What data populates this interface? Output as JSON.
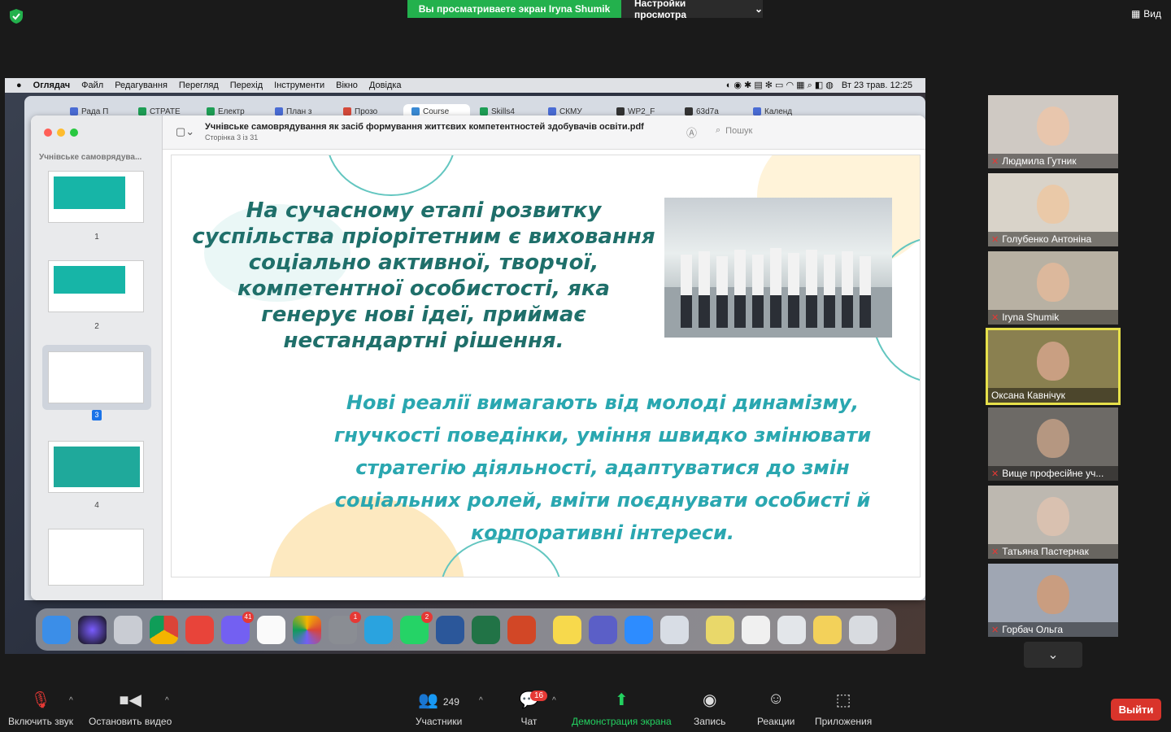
{
  "banner": {
    "viewing": "Вы просматриваете экран Iryna Shumik",
    "settings": "Настройки просмотра",
    "view": "Вид"
  },
  "menubar": {
    "items": [
      "Оглядач",
      "Файл",
      "Редагування",
      "Перегляд",
      "Перехід",
      "Інструменти",
      "Вікно",
      "Довідка"
    ],
    "datetime": "Вт 23 трав.  12:25"
  },
  "browser_tabs": [
    {
      "label": "Рада П",
      "color": "#4a6cd4"
    },
    {
      "label": "СТРАТЕ",
      "color": "#1e9e55"
    },
    {
      "label": "Електр",
      "color": "#1e9e55"
    },
    {
      "label": "План з",
      "color": "#4a6cd4"
    },
    {
      "label": "Прозо",
      "color": "#d44a3a"
    },
    {
      "label": "Course",
      "color": "#3a8ad4"
    },
    {
      "label": "Skills4",
      "color": "#1e9e55"
    },
    {
      "label": "СКМУ",
      "color": "#4a6cd4"
    },
    {
      "label": "WP2_F",
      "color": "#333333"
    },
    {
      "label": "63d7a",
      "color": "#333333"
    },
    {
      "label": "Календ",
      "color": "#4a6cd4"
    }
  ],
  "preview": {
    "sidebar_title": "Учнівське самоврядува...",
    "doc_title": "Учнівське самоврядування як засіб формування життєвих компетентностей здобувачів освіти.pdf",
    "page_info": "Сторінка 3 із 31",
    "search_placeholder": "Пошук",
    "thumb_numbers": [
      "1",
      "2",
      "3",
      "4"
    ]
  },
  "slide": {
    "heading": "На сучасному етапі розвитку суспільства пріорітетним є виховання  соціально активної, творчої, компетентної особистості, яка генерує нові ідеї, приймає нестандартні рішення.",
    "body": "Нові реалії вимагають від молоді динамізму, гнучкості поведінки, уміння швидко змінювати стратегію діяльності, адаптуватися до змін соціальних ролей, вміти поєднувати особисті й корпоративні інтереси."
  },
  "dock_badges": {
    "viber": "41",
    "settings": "1",
    "whatsapp": "2"
  },
  "participants": [
    "Людмила Гутник",
    "Голубенко Антоніна",
    "Iryna Shumik",
    "Оксана Кавнічук",
    "Вище професійне уч...",
    "Татьяна Пастернак",
    "Горбач Ольга"
  ],
  "toolbar": {
    "mute": "Включить звук",
    "video": "Остановить видео",
    "participants": "Участники",
    "participants_count": "249",
    "chat": "Чат",
    "chat_badge": "16",
    "share": "Демонстрация экрана",
    "record": "Запись",
    "reactions": "Реакции",
    "apps": "Приложения",
    "leave": "Выйти"
  },
  "colors": {
    "accent_green": "#23b14d",
    "leave_red": "#d9342b",
    "slide_teal": "#1f6f6a",
    "slide_cyan": "#2aa7b0"
  }
}
